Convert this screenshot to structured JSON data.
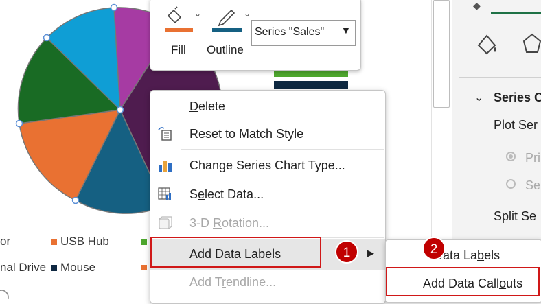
{
  "legend": [
    {
      "label": "or",
      "color": "#e07a2e"
    },
    {
      "label": "USB Hub",
      "color": "#e97132"
    },
    {
      "label": "nal Drive",
      "color": "#e97132"
    },
    {
      "label": "Mouse",
      "color": "#0e2841"
    }
  ],
  "toolbar": {
    "fill_label": "Fill",
    "outline_label": "Outline",
    "series_select_value": "Series \"Sales\""
  },
  "context_menu": {
    "items": [
      {
        "label": "Delete",
        "enabled": true
      },
      {
        "label": "Reset to Match Style",
        "enabled": true
      },
      {
        "label": "Change Series Chart Type...",
        "enabled": true
      },
      {
        "label": "Select Data...",
        "enabled": true
      },
      {
        "label": "3-D Rotation...",
        "enabled": false
      },
      {
        "label": "Add Data Labels",
        "enabled": true
      },
      {
        "label": "Add Trendline...",
        "enabled": false
      }
    ]
  },
  "submenu": {
    "items": [
      {
        "label": "Add Data Labels"
      },
      {
        "label": "Add Data Callouts"
      }
    ]
  },
  "badges": [
    "1",
    "2"
  ],
  "pane": {
    "section_title": "Series O",
    "plot_series_label": "Plot Ser",
    "primary_label": "Pri",
    "secondary_label": "Se",
    "split_label": "Split Se"
  },
  "colors": {
    "accent_red": "#d01818",
    "pie_purple": "#9b2c9b",
    "pie_blue": "#0f9ed5",
    "pie_green": "#196b24",
    "pie_orange": "#e97132",
    "pie_teal": "#156082",
    "pie_dark": "#4a1c52"
  }
}
